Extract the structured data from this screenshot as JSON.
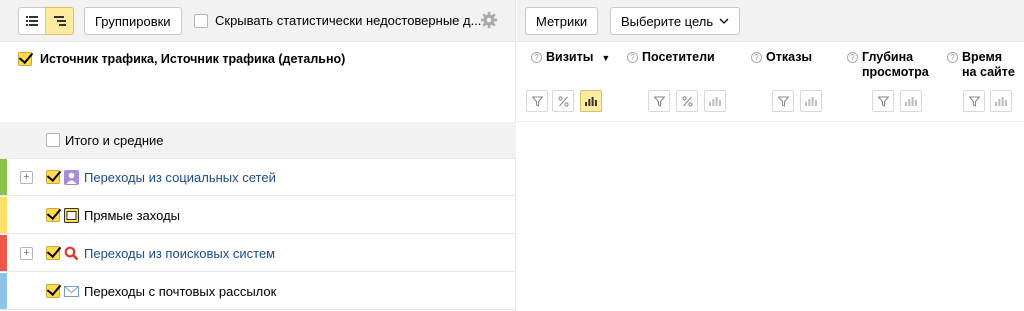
{
  "toolbar": {
    "groupings_label": "Группировки",
    "hide_stat_label": "Скрывать статистически недостоверные д..."
  },
  "right_toolbar": {
    "metrics_label": "Метрики",
    "goal_label": "Выберите цель"
  },
  "table_header": {
    "dimension_label": "Источник трафика, Источник трафика (детально)"
  },
  "total_row": {
    "label": "Итого и средние"
  },
  "rows": [
    {
      "label": "Переходы из социальных сетей",
      "color": "#8bc34a",
      "expandable": true,
      "icon": "user-icon"
    },
    {
      "label": "Прямые заходы",
      "color": "#ffe066",
      "expandable": false,
      "icon": "window-icon"
    },
    {
      "label": "Переходы из поисковых систем",
      "color": "#f0574a",
      "expandable": true,
      "icon": "search-icon"
    },
    {
      "label": "Переходы с почтовых рассылок",
      "color": "#8ec3e8",
      "expandable": false,
      "icon": "envelope-icon"
    }
  ],
  "metrics": [
    {
      "label": "Визиты",
      "sort": "▼"
    },
    {
      "label": "Посетители"
    },
    {
      "label": "Отказы"
    },
    {
      "label_line1": "Глубина",
      "label_line2": "просмотра"
    },
    {
      "label_line1": "Время",
      "label_line2": "на сайте"
    }
  ],
  "colors": {
    "accent": "#ffdb4d",
    "link": "#1c4b8f"
  }
}
